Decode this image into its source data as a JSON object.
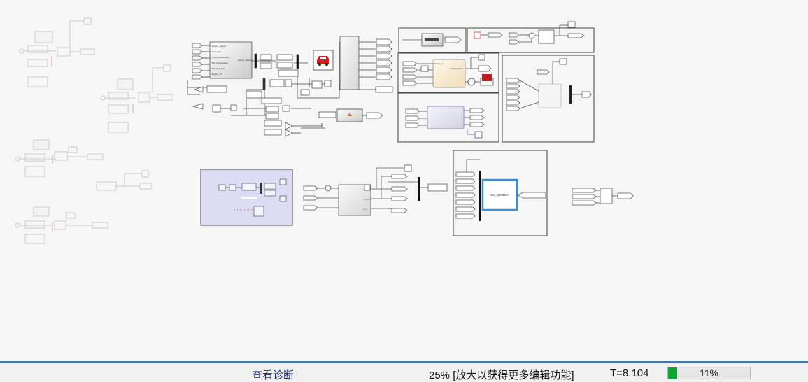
{
  "status_bar": {
    "diagnostics_link": "查看诊断",
    "zoom_text": "25% [放大以获得更多编辑功能]",
    "sim_time": "T=8.104",
    "progress_label": "11%",
    "progress_fraction": 0.11,
    "progress_color": "#0aa52c",
    "accent_color": "#4a7ab0"
  },
  "model": {
    "block_labels": {
      "vehicle_outputs": [
        "Engine_Speed",
        "Gear_Sel",
        "Accel_Acceleration",
        "Brk_Acceleration",
        "Brk_Pos_Rat",
        "Engine_TT"
      ],
      "vehicle_output_right": "Engine_Speed",
      "controller_in": "Engine_1",
      "controller_out": "Control_Word",
      "io_block": "acc_operation",
      "mid_block_inputs": [
        "En_cmd",
        "In_cmd",
        "In_T"
      ]
    }
  }
}
